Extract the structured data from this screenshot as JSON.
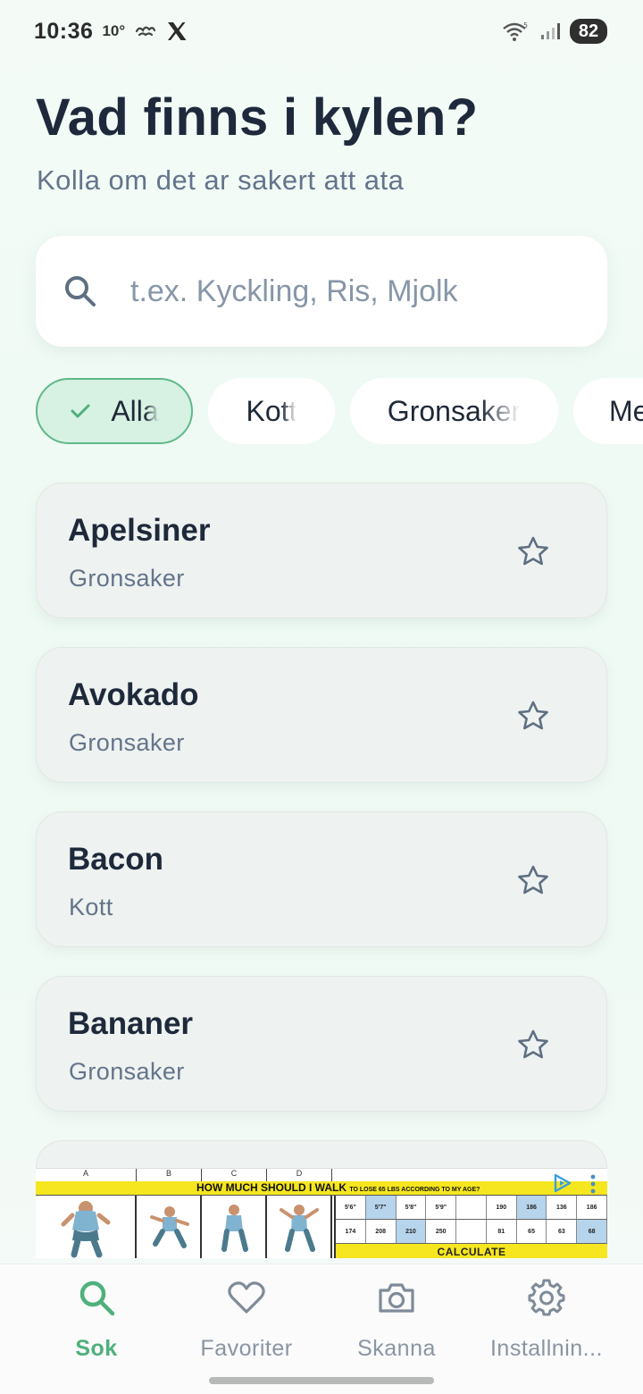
{
  "status_bar": {
    "time": "10:36",
    "temperature": "10°",
    "icons": [
      "weather-icon",
      "x-logo-icon",
      "wifi-icon",
      "signal-icon"
    ],
    "battery": "82"
  },
  "header": {
    "title": "Vad finns i kylen?",
    "subtitle": "Kolla om det ar sakert att ata"
  },
  "search": {
    "placeholder": "t.ex. Kyckling, Ris, Mjolk",
    "value": ""
  },
  "filters": [
    {
      "label": "Alla",
      "active": true
    },
    {
      "label": "Kott",
      "active": false
    },
    {
      "label": "Gronsaker",
      "active": false
    },
    {
      "label": "Me",
      "active": false
    }
  ],
  "items": [
    {
      "name": "Apelsiner",
      "category": "Gronsaker"
    },
    {
      "name": "Avokado",
      "category": "Gronsaker"
    },
    {
      "name": "Bacon",
      "category": "Kott"
    },
    {
      "name": "Bananer",
      "category": "Gronsaker"
    }
  ],
  "ad": {
    "columns": [
      "A",
      "B",
      "C",
      "D"
    ],
    "headline": "HOW MUCH SHOULD I WALK",
    "headline_small": "TO LOSE 65 LBS ACCORDING TO MY AGE?",
    "row1": [
      "5'6\"",
      "5'7\"",
      "5'8\"",
      "5'9\"",
      "",
      "190",
      "186",
      "136",
      "186"
    ],
    "row2": [
      "174",
      "208",
      "210",
      "250",
      "",
      "81",
      "65",
      "63",
      "68"
    ],
    "calculate": "CALCULATE"
  },
  "bottom_nav": [
    {
      "label": "Sok",
      "icon": "search-icon",
      "active": true
    },
    {
      "label": "Favoriter",
      "icon": "heart-icon",
      "active": false
    },
    {
      "label": "Skanna",
      "icon": "camera-icon",
      "active": false
    },
    {
      "label": "Installnin...",
      "icon": "gear-icon",
      "active": false
    }
  ],
  "colors": {
    "accent": "#4fb07c",
    "chip_active_bg": "#d7f1e2",
    "title": "#1e293b",
    "muted": "#64748b"
  }
}
